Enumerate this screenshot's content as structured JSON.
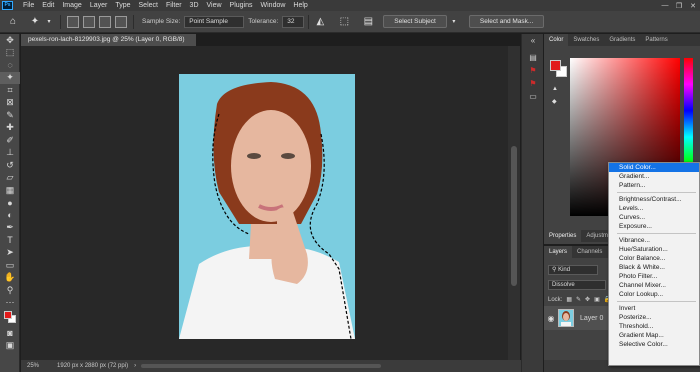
{
  "menubar": {
    "logo": "Ps",
    "items": [
      "File",
      "Edit",
      "Image",
      "Layer",
      "Type",
      "Select",
      "Filter",
      "3D",
      "View",
      "Plugins",
      "Window",
      "Help"
    ],
    "controls": [
      "—",
      "❐",
      "✕"
    ]
  },
  "options": {
    "sample_size_label": "Sample Size:",
    "sample_size_value": "Point Sample",
    "tolerance_label": "Tolerance:",
    "tolerance_value": "32",
    "select_subject": "Select Subject",
    "select_and_mask": "Select and Mask..."
  },
  "document": {
    "tab_title": "pexels-ron-lach-8129903.jpg @ 25% (Layer 0, RGB/8) *",
    "close": "×",
    "zoom": "25%",
    "doc_info": "1920 px x 2880 px (72 ppi)",
    "colors": {
      "backdrop": "#7bcde0",
      "hair": "#8a3a1c",
      "skin": "#e6b79f",
      "shirt": "#f4f4f4"
    }
  },
  "color_panel": {
    "tabs": [
      "Color",
      "Swatches",
      "Gradients",
      "Patterns"
    ],
    "foreground": "#e21a1a",
    "background": "#ffffff"
  },
  "properties_panel": {
    "tabs": [
      "Properties",
      "Adjustm"
    ]
  },
  "layers_panel": {
    "tabs": [
      "Layers",
      "Channels"
    ],
    "kind_label": "Kind",
    "blend_mode": "Dissolve",
    "lock_label": "Lock:",
    "layer_name": "Layer 0"
  },
  "context_menu": {
    "group1": [
      "Solid Color...",
      "Gradient...",
      "Pattern..."
    ],
    "group2": [
      "Brightness/Contrast...",
      "Levels...",
      "Curves...",
      "Exposure..."
    ],
    "group3": [
      "Vibrance...",
      "Hue/Saturation...",
      "Color Balance...",
      "Black & White...",
      "Photo Filter...",
      "Channel Mixer...",
      "Color Lookup..."
    ],
    "group4": [
      "Invert",
      "Posterize...",
      "Threshold...",
      "Gradient Map...",
      "Selective Color..."
    ],
    "highlighted": "Solid Color..."
  }
}
